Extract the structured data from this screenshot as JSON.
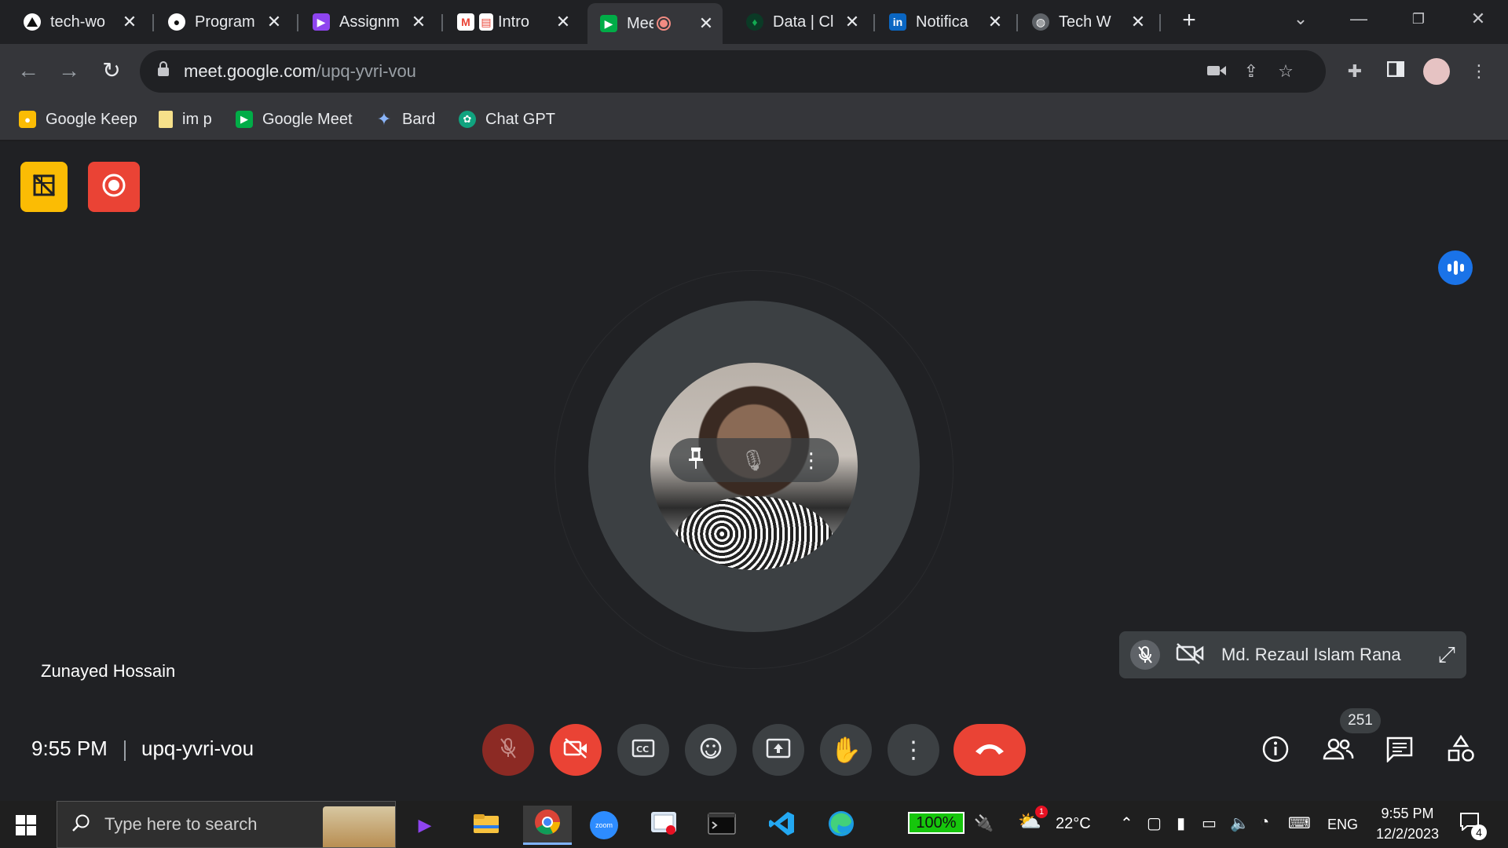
{
  "browser": {
    "tabs": [
      {
        "title": "tech-wo",
        "icon": "triangle-logo-icon",
        "color": "#ffffff"
      },
      {
        "title": "Program",
        "icon": "github-icon",
        "color": "#ffffff"
      },
      {
        "title": "Assignm",
        "icon": "video-course-icon",
        "color": "#8e44ef"
      },
      {
        "title": "Intro",
        "icon": "gmail-icon",
        "color": "#ea4335"
      },
      {
        "title": "Mee",
        "icon": "google-meet-icon",
        "color": "#00ac47",
        "active": true
      },
      {
        "title": "Data | Cl",
        "icon": "mongodb-leaf-icon",
        "color": "#13aa52"
      },
      {
        "title": "Notifica",
        "icon": "linkedin-icon",
        "color": "#0a66c2"
      },
      {
        "title": "Tech W",
        "icon": "globe-icon",
        "color": "#9aa0a6"
      }
    ],
    "url_host": "meet.google.com",
    "url_path": "/upq-yvri-vou",
    "bookmarks": [
      {
        "label": "Google Keep",
        "icon": "keep-icon",
        "color": "#fbbc04"
      },
      {
        "label": "im p",
        "icon": "folder-icon",
        "color": "#f6e08a"
      },
      {
        "label": "Google Meet",
        "icon": "google-meet-icon",
        "color": "#00ac47"
      },
      {
        "label": "Bard",
        "icon": "bard-sparkle-icon",
        "color": "#8ab4f8"
      },
      {
        "label": "Chat GPT",
        "icon": "chatgpt-icon",
        "color": "#10a37f"
      }
    ]
  },
  "meet": {
    "main_participant": "Zunayed Hossain",
    "secondary_participant": "Md. Rezaul Islam Rana",
    "clock": "9:55 PM",
    "meeting_code": "upq-yvri-vou",
    "people_count": "251",
    "colors": {
      "accent_red": "#ea4335",
      "badge_yellow": "#fbbc04",
      "speaking_blue": "#1a73e8"
    }
  },
  "taskbar": {
    "search_placeholder": "Type here to search",
    "battery": "100%",
    "weather_temp": "22°C",
    "weather_alert_count": "1",
    "language": "ENG",
    "time": "9:55 PM",
    "date": "12/2/2023",
    "notification_count": "4"
  }
}
